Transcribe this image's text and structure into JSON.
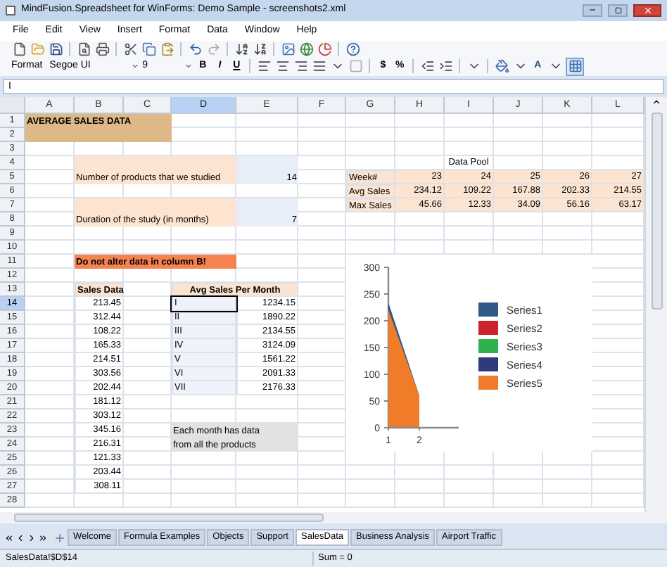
{
  "window": {
    "title": "MindFusion.Spreadsheet for WinForms: Demo Sample - screenshots2.xml"
  },
  "menu": [
    "File",
    "Edit",
    "View",
    "Insert",
    "Format",
    "Data",
    "Window",
    "Help"
  ],
  "format_bar": {
    "label": "Format",
    "font": "Segoe UI",
    "size": "9",
    "bold": "B",
    "italic": "I",
    "underline": "U",
    "currency": "$",
    "percent": "%",
    "font_color": "A"
  },
  "formula_bar": {
    "value": "I"
  },
  "columns": [
    {
      "label": "A",
      "selected": false
    },
    {
      "label": "B",
      "selected": false
    },
    {
      "label": "C",
      "selected": false
    },
    {
      "label": "D",
      "selected": true
    },
    {
      "label": "E",
      "selected": false
    },
    {
      "label": "F",
      "selected": false
    },
    {
      "label": "G",
      "selected": false
    },
    {
      "label": "H",
      "selected": false
    },
    {
      "label": "I",
      "selected": false
    },
    {
      "label": "J",
      "selected": false
    },
    {
      "label": "K",
      "selected": false
    },
    {
      "label": "L",
      "selected": false
    }
  ],
  "rows": [
    {
      "header": "1",
      "selected": false,
      "cells": [
        {
          "text": "AVERAGE SALES DATA",
          "kind": "banner"
        },
        {
          "kind": "banner"
        },
        {
          "kind": "banner"
        },
        {},
        {},
        {},
        {},
        {},
        {},
        {},
        {},
        {}
      ]
    },
    {
      "header": "2",
      "selected": false,
      "cells": [
        {
          "kind": "banner"
        },
        {
          "kind": "banner"
        },
        {
          "kind": "banner"
        },
        {},
        {},
        {},
        {},
        {},
        {},
        {},
        {},
        {}
      ]
    },
    {
      "header": "3",
      "selected": false,
      "cells": [
        {},
        {},
        {},
        {},
        {},
        {},
        {},
        {},
        {},
        {},
        {},
        {}
      ]
    },
    {
      "header": "4",
      "selected": false,
      "cells": [
        {},
        {
          "kind": "peach"
        },
        {
          "kind": "peach"
        },
        {
          "kind": "peach"
        },
        {
          "kind": "input"
        },
        {},
        {},
        {},
        {
          "text": "Data Pool",
          "kind": "caption"
        },
        {},
        {},
        {}
      ]
    },
    {
      "header": "5",
      "selected": false,
      "cells": [
        {},
        {
          "text": "Number of products that we studied",
          "kind": "peach"
        },
        {
          "kind": "peach"
        },
        {
          "kind": "peach"
        },
        {
          "text": "14",
          "kind": "input"
        },
        {},
        {
          "text": "Week#",
          "kind": "pool-label"
        },
        {
          "text": "23",
          "kind": "pool"
        },
        {
          "text": "24",
          "kind": "pool"
        },
        {
          "text": "25",
          "kind": "pool"
        },
        {
          "text": "26",
          "kind": "pool"
        },
        {
          "text": "27",
          "kind": "pool"
        }
      ]
    },
    {
      "header": "6",
      "selected": false,
      "cells": [
        {},
        {},
        {},
        {},
        {},
        {},
        {
          "text": "Avg Sales",
          "kind": "pool-label"
        },
        {
          "text": "234.12",
          "kind": "pool"
        },
        {
          "text": "109.22",
          "kind": "pool"
        },
        {
          "text": "167.88",
          "kind": "pool"
        },
        {
          "text": "202.33",
          "kind": "pool"
        },
        {
          "text": "214.55",
          "kind": "pool"
        }
      ]
    },
    {
      "header": "7",
      "selected": false,
      "cells": [
        {},
        {
          "kind": "peach"
        },
        {
          "kind": "peach"
        },
        {
          "kind": "peach"
        },
        {
          "kind": "input"
        },
        {},
        {
          "text": "Max Sales",
          "kind": "pool-label"
        },
        {
          "text": "45.66",
          "kind": "pool"
        },
        {
          "text": "12.33",
          "kind": "pool"
        },
        {
          "text": "34.09",
          "kind": "pool"
        },
        {
          "text": "56.16",
          "kind": "pool"
        },
        {
          "text": "63.17",
          "kind": "pool"
        }
      ]
    },
    {
      "header": "8",
      "selected": false,
      "cells": [
        {},
        {
          "text": "Duration of the study (in months)",
          "kind": "peach"
        },
        {
          "kind": "peach"
        },
        {
          "kind": "peach"
        },
        {
          "text": "7",
          "kind": "input"
        },
        {},
        {},
        {},
        {},
        {},
        {},
        {}
      ]
    },
    {
      "header": "9",
      "selected": false,
      "cells": [
        {},
        {},
        {},
        {},
        {},
        {},
        {},
        {},
        {},
        {},
        {},
        {}
      ]
    },
    {
      "header": "10",
      "selected": false,
      "cells": [
        {},
        {},
        {},
        {},
        {},
        {},
        {},
        {},
        {},
        {},
        {},
        {}
      ]
    },
    {
      "header": "11",
      "selected": false,
      "cells": [
        {},
        {
          "text": "Do not alter data in column B!",
          "kind": "warn"
        },
        {
          "kind": "warn"
        },
        {
          "kind": "warn"
        },
        {},
        {},
        {},
        {},
        {},
        {},
        {},
        {}
      ]
    },
    {
      "header": "12",
      "selected": false,
      "cells": [
        {},
        {},
        {},
        {},
        {},
        {},
        {},
        {},
        {},
        {},
        {},
        {}
      ]
    },
    {
      "header": "13",
      "selected": false,
      "cells": [
        {},
        {
          "text": "Sales Data",
          "kind": "head"
        },
        {},
        {
          "text": "Avg Sales Per Month",
          "kind": "head"
        },
        {
          "kind": "head"
        },
        {},
        {},
        {},
        {},
        {},
        {},
        {}
      ]
    },
    {
      "header": "14",
      "selected": true,
      "cells": [
        {},
        {
          "text": "213.45",
          "kind": "boxed"
        },
        {},
        {
          "text": "I",
          "kind": "numeral"
        },
        {
          "text": "1234.15",
          "kind": "boxed"
        },
        {},
        {},
        {},
        {},
        {},
        {},
        {}
      ]
    },
    {
      "header": "15",
      "selected": false,
      "cells": [
        {},
        {
          "text": "312.44",
          "kind": "boxed"
        },
        {},
        {
          "text": "II",
          "kind": "numeral"
        },
        {
          "text": "1890.22",
          "kind": "boxed"
        },
        {},
        {},
        {},
        {},
        {},
        {},
        {}
      ]
    },
    {
      "header": "16",
      "selected": false,
      "cells": [
        {},
        {
          "text": "108.22",
          "kind": "boxed"
        },
        {},
        {
          "text": "III",
          "kind": "numeral"
        },
        {
          "text": "2134.55",
          "kind": "boxed"
        },
        {},
        {},
        {},
        {},
        {},
        {},
        {}
      ]
    },
    {
      "header": "17",
      "selected": false,
      "cells": [
        {},
        {
          "text": "165.33",
          "kind": "boxed"
        },
        {},
        {
          "text": "IV",
          "kind": "numeral"
        },
        {
          "text": "3124.09",
          "kind": "boxed"
        },
        {},
        {},
        {},
        {},
        {},
        {},
        {}
      ]
    },
    {
      "header": "18",
      "selected": false,
      "cells": [
        {},
        {
          "text": "214.51",
          "kind": "boxed"
        },
        {},
        {
          "text": "V",
          "kind": "numeral"
        },
        {
          "text": "1561.22",
          "kind": "boxed"
        },
        {},
        {},
        {},
        {},
        {},
        {},
        {}
      ]
    },
    {
      "header": "19",
      "selected": false,
      "cells": [
        {},
        {
          "text": "303.56",
          "kind": "boxed"
        },
        {},
        {
          "text": "VI",
          "kind": "numeral"
        },
        {
          "text": "2091.33",
          "kind": "boxed"
        },
        {},
        {},
        {},
        {},
        {},
        {},
        {}
      ]
    },
    {
      "header": "20",
      "selected": false,
      "cells": [
        {},
        {
          "text": "202.44",
          "kind": "boxed"
        },
        {},
        {
          "text": "VII",
          "kind": "numeral"
        },
        {
          "text": "2176.33",
          "kind": "boxed"
        },
        {},
        {},
        {},
        {},
        {},
        {},
        {}
      ]
    },
    {
      "header": "21",
      "selected": false,
      "cells": [
        {},
        {
          "text": "181.12",
          "kind": "boxed"
        },
        {},
        {},
        {},
        {},
        {},
        {},
        {},
        {},
        {},
        {}
      ]
    },
    {
      "header": "22",
      "selected": false,
      "cells": [
        {},
        {
          "text": "303.12",
          "kind": "boxed"
        },
        {},
        {},
        {},
        {},
        {},
        {},
        {},
        {},
        {},
        {}
      ]
    },
    {
      "header": "23",
      "selected": false,
      "cells": [
        {},
        {
          "text": "345.16",
          "kind": "boxed"
        },
        {},
        {
          "text": "Each month has data",
          "kind": "note"
        },
        {
          "kind": "note"
        },
        {},
        {},
        {},
        {},
        {},
        {},
        {}
      ]
    },
    {
      "header": "24",
      "selected": false,
      "cells": [
        {},
        {
          "text": "216.31",
          "kind": "boxed"
        },
        {},
        {
          "text": "from all the products",
          "kind": "note"
        },
        {
          "kind": "note"
        },
        {},
        {},
        {},
        {},
        {},
        {},
        {}
      ]
    },
    {
      "header": "25",
      "selected": false,
      "cells": [
        {},
        {
          "text": "121.33",
          "kind": "boxed"
        },
        {},
        {},
        {},
        {},
        {},
        {},
        {},
        {},
        {},
        {}
      ]
    },
    {
      "header": "26",
      "selected": false,
      "cells": [
        {},
        {
          "text": "203.44",
          "kind": "boxed"
        },
        {},
        {},
        {},
        {},
        {},
        {},
        {},
        {},
        {},
        {}
      ]
    },
    {
      "header": "27",
      "selected": false,
      "cells": [
        {},
        {
          "text": "308.11",
          "kind": "boxed"
        },
        {},
        {},
        {},
        {},
        {},
        {},
        {},
        {},
        {},
        {}
      ]
    },
    {
      "header": "28",
      "selected": false,
      "cells": [
        {},
        {},
        {},
        {},
        {},
        {},
        {},
        {},
        {},
        {},
        {},
        {}
      ]
    }
  ],
  "chart": {
    "chart_data": {
      "type": "area",
      "legend": true,
      "categories": [
        "1",
        "2"
      ],
      "ylim": [
        0,
        300
      ],
      "yticks": [
        0,
        50,
        100,
        150,
        200,
        250,
        300
      ],
      "series": [
        {
          "name": "Series1",
          "color": "#2f5a8a",
          "values": [
            234,
            60
          ]
        },
        {
          "name": "Series2",
          "color": "#cc2229",
          "values": [
            null,
            null
          ]
        },
        {
          "name": "Series3",
          "color": "#2db34a",
          "values": [
            null,
            null
          ]
        },
        {
          "name": "Series4",
          "color": "#2e3a7a",
          "values": [
            null,
            null
          ]
        },
        {
          "name": "Series5",
          "color": "#f07c2a",
          "values": [
            220,
            60
          ]
        }
      ]
    }
  },
  "sheet_tabs": [
    {
      "label": "Welcome",
      "selected": false
    },
    {
      "label": "Formula Examples",
      "selected": false
    },
    {
      "label": "Objects",
      "selected": false
    },
    {
      "label": "Support",
      "selected": false
    },
    {
      "label": "SalesData",
      "selected": true
    },
    {
      "label": "Business Analysis",
      "selected": false
    },
    {
      "label": "Airport Traffic",
      "selected": false
    }
  ],
  "status_bar": {
    "cell": "SalesData!$D$14",
    "sum": "Sum = 0"
  }
}
